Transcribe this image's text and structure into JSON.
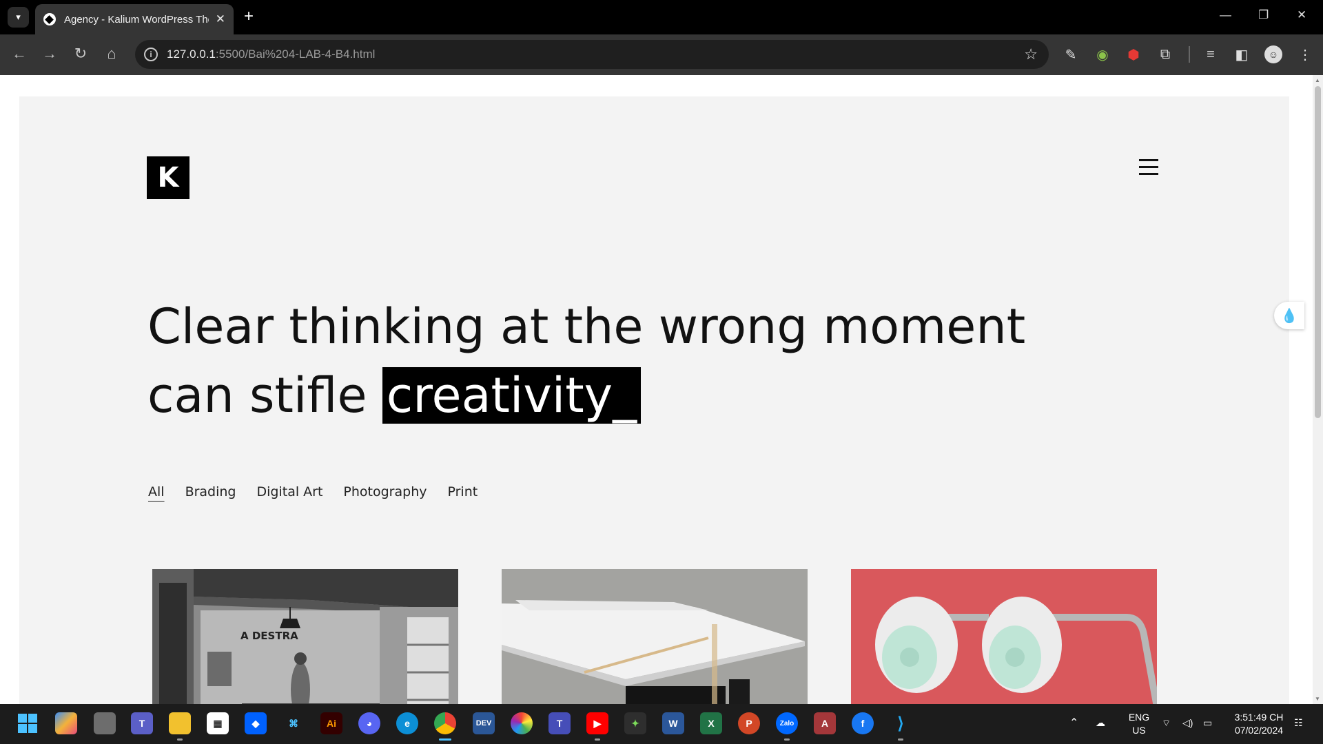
{
  "browser": {
    "tab_title": "Agency - Kalium WordPress Theme",
    "url_host": "127.0.0.1",
    "url_path": ":5500/Bai%204-LAB-4-B4.html"
  },
  "page": {
    "headline_text": "Clear thinking at the wrong moment can stifle ",
    "headline_highlight": "creativity_",
    "filters": [
      "All",
      "Brading",
      "Digital Art",
      "Photography",
      "Print"
    ],
    "active_filter": "All",
    "portfolio_images": [
      "black-and-white office studio with A DESTRA wall lettering",
      "white modular table against concrete wall",
      "two white lamps with mint-green speaker grilles on red background"
    ],
    "wall_text": "A DESTRA"
  },
  "taskbar": {
    "lang_top": "ENG",
    "lang_bottom": "US",
    "time": "3:51:49 CH",
    "date": "07/02/2024",
    "apps": [
      "windows-start",
      "copilot",
      "task-view",
      "teams",
      "file-explorer",
      "microsoft-store",
      "dropbox",
      "terminal",
      "illustrator",
      "discord",
      "edge",
      "chrome",
      "dev-home",
      "color-picker",
      "teams-classic",
      "youtube",
      "git-kraken",
      "word",
      "excel",
      "powerpoint",
      "zalo",
      "access",
      "facebook",
      "vscode"
    ]
  },
  "colors": {
    "page_bg": "#f3f3f3",
    "highlight_bg": "#000000",
    "accent_blue": "#4cc2ff"
  }
}
